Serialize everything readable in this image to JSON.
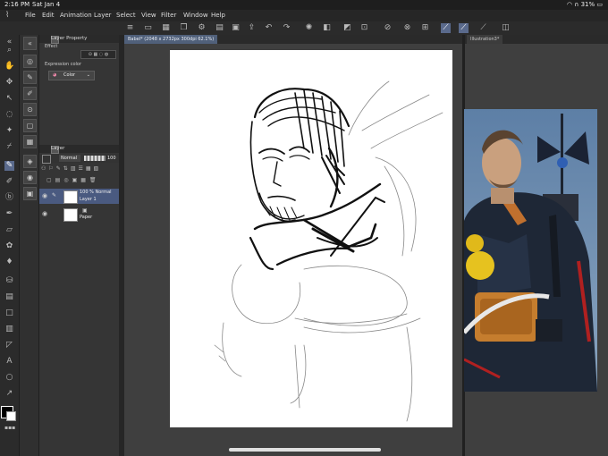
{
  "status": {
    "time": "2:16 PM",
    "date": "Sat Jan 4",
    "battery": "31%",
    "wifi_icon": "wifi-icon",
    "battery_icon": "battery-icon"
  },
  "menu": {
    "items": [
      "File",
      "Edit",
      "Animation",
      "Layer",
      "Select",
      "View",
      "Filter",
      "Window",
      "Help"
    ]
  },
  "layer_property": {
    "title": "Layer Property",
    "effect_label": "Effect",
    "expression_label": "Expression color",
    "color_value": "Color"
  },
  "layer_panel": {
    "title": "Layer",
    "blend_mode": "Normal",
    "opacity": "100",
    "layers": [
      {
        "name": "Layer 1",
        "mode": "100 % Normal",
        "selected": true
      },
      {
        "name": "Paper",
        "mode": "",
        "selected": false
      }
    ]
  },
  "tabs": {
    "main": "Babel* (2048 x 2732px 300dpi 62.1%)",
    "second": "Illustration3*"
  },
  "colors": {
    "accent": "#5a6a8c",
    "selection": "#4a5a80",
    "background": "#3a3a3a"
  }
}
